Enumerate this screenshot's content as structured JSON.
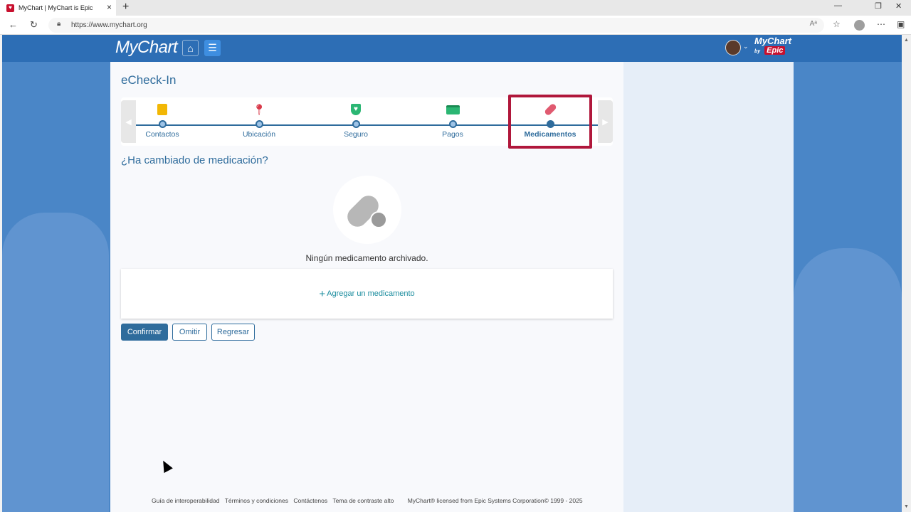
{
  "browser": {
    "tab_title": "MyChart | MyChart is Epic",
    "url": "https://www.mychart.org"
  },
  "header": {
    "logo": "MyChart",
    "brand_line1": "MyChart",
    "brand_by": "by",
    "brand_epic": "Epic"
  },
  "page": {
    "title": "eCheck-In",
    "question": "¿Ha cambiado de medicación?",
    "empty_text": "Ningún medicamento archivado.",
    "add_link": "Agregar un medicamento"
  },
  "steps": [
    {
      "label": "Contactos",
      "icon": "contacts-icon",
      "color": "#f2b705"
    },
    {
      "label": "Ubicación",
      "icon": "location-pin-icon",
      "color": "#d93a4a"
    },
    {
      "label": "Seguro",
      "icon": "shield-icon",
      "color": "#2bb673"
    },
    {
      "label": "Pagos",
      "icon": "credit-card-icon",
      "color": "#2bb673"
    },
    {
      "label": "Medicamentos",
      "icon": "pill-icon",
      "color": "#e05a70",
      "active": true
    }
  ],
  "buttons": {
    "confirm": "Confirmar",
    "skip": "Omitir",
    "back": "Regresar"
  },
  "footer": {
    "links": [
      "Guía de interoperabilidad",
      "Términos y condiciones",
      "Contáctenos",
      "Tema de contraste alto"
    ],
    "copyright": "MyChart® licensed from Epic Systems Corporation© 1999 - 2025"
  },
  "colors": {
    "header": "#2d6eb5",
    "accent": "#2f6c9c",
    "highlight": "#b0173b",
    "link": "#1a8c9e"
  }
}
